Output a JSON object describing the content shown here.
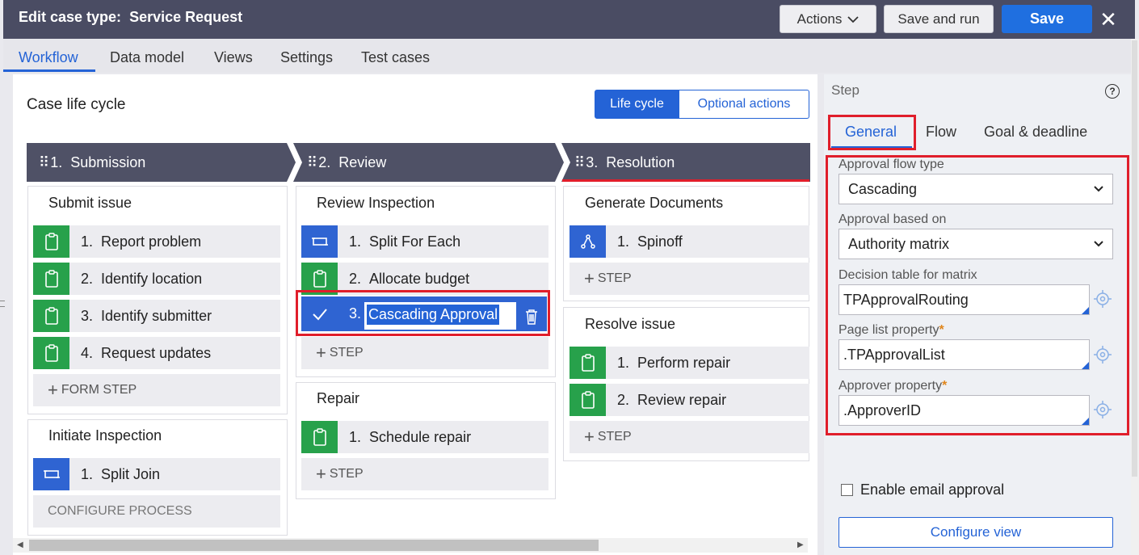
{
  "header": {
    "title_prefix": "Edit case type:",
    "title_name": "Service Request",
    "actions_label": "Actions",
    "save_run_label": "Save and run",
    "save_label": "Save",
    "close_glyph": "✕"
  },
  "tabs": [
    "Workflow",
    "Data model",
    "Views",
    "Settings",
    "Test cases"
  ],
  "main": {
    "title": "Case life cycle",
    "segments": [
      "Life cycle",
      "Optional actions"
    ]
  },
  "stages": [
    {
      "number": "1.",
      "name": "Submission",
      "processes": [
        {
          "title": "Submit issue",
          "steps": [
            {
              "num": "1.",
              "label": "Report problem",
              "icon": "clipboard-icon"
            },
            {
              "num": "2.",
              "label": "Identify location",
              "icon": "clipboard-icon"
            },
            {
              "num": "3.",
              "label": "Identify submitter",
              "icon": "clipboard-icon"
            },
            {
              "num": "4.",
              "label": "Request updates",
              "icon": "clipboard-icon"
            }
          ],
          "add_label": "FORM STEP"
        },
        {
          "title": "Initiate Inspection",
          "steps": [
            {
              "num": "1.",
              "label": "Split Join",
              "icon": "split-icon"
            }
          ],
          "add_label": "CONFIGURE PROCESS"
        }
      ]
    },
    {
      "number": "2.",
      "name": "Review",
      "processes": [
        {
          "title": "Review Inspection",
          "steps": [
            {
              "num": "1.",
              "label": "Split For Each",
              "icon": "split-icon"
            },
            {
              "num": "2.",
              "label": "Allocate budget",
              "icon": "clipboard-icon"
            },
            {
              "num": "3.",
              "label": "Cascading Approval",
              "icon": "check-icon"
            }
          ],
          "add_label": "STEP"
        },
        {
          "title": "Repair",
          "steps": [
            {
              "num": "1.",
              "label": "Schedule repair",
              "icon": "clipboard-icon"
            }
          ],
          "add_label": "STEP"
        }
      ]
    },
    {
      "number": "3.",
      "name": "Resolution",
      "processes": [
        {
          "title": "Generate Documents",
          "steps": [
            {
              "num": "1.",
              "label": "Spinoff",
              "icon": "spinoff-icon"
            }
          ],
          "add_label": "STEP"
        },
        {
          "title": "Resolve issue",
          "steps": [
            {
              "num": "1.",
              "label": "Perform repair",
              "icon": "clipboard-icon"
            },
            {
              "num": "2.",
              "label": "Review repair",
              "icon": "clipboard-icon"
            }
          ],
          "add_label": "STEP"
        }
      ]
    }
  ],
  "panel": {
    "title": "Step",
    "help_glyph": "?",
    "tabs": [
      "General",
      "Flow",
      "Goal & deadline"
    ],
    "fields": {
      "approval_flow_type": {
        "label": "Approval flow type",
        "value": "Cascading"
      },
      "approval_based_on": {
        "label": "Approval based on",
        "value": "Authority matrix"
      },
      "decision_table": {
        "label": "Decision table for matrix",
        "value": "TPApprovalRouting"
      },
      "page_list": {
        "label": "Page list property",
        "value": ".TPApprovalList",
        "required": "*"
      },
      "approver": {
        "label": "Approver property",
        "value": ".ApproverID",
        "required": "*"
      }
    },
    "email_approval_label": "Enable email approval",
    "email_approval_checked": false,
    "configure_view_label": "Configure view"
  },
  "colors": {
    "accent": "#2463d6",
    "header_bg": "#4a4c63",
    "stage_bg": "#4f5166",
    "step_green": "#27a14b",
    "step_blue": "#2f64d2",
    "highlight_red": "#e01e2b"
  }
}
